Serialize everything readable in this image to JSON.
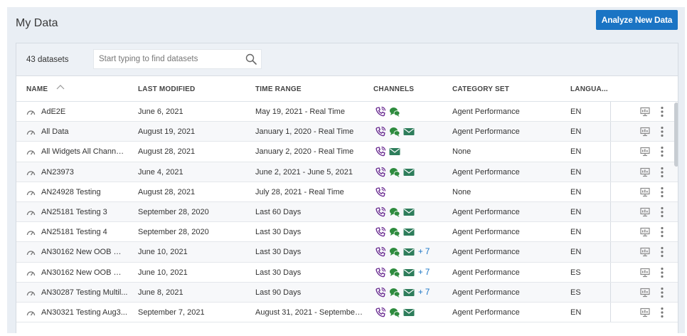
{
  "page": {
    "title": "My Data",
    "analyze_button": "Analyze New Data"
  },
  "toolbar": {
    "count": "43 datasets",
    "search_placeholder": "Start typing to find datasets"
  },
  "columns": {
    "name": "NAME",
    "last_modified": "LAST MODIFIED",
    "time_range": "TIME RANGE",
    "channels": "CHANNELS",
    "category_set": "CATEGORY SET",
    "language": "LANGUA..."
  },
  "colors": {
    "accent": "#1a74c4",
    "voice": "#6a2c91",
    "chat": "#2e8b3e",
    "email": "#2e7d5b"
  },
  "rows": [
    {
      "name": "AdE2E",
      "modified": "June 6, 2021",
      "time_range": "May 19, 2021 - Real Time",
      "channels": [
        "voice",
        "chat"
      ],
      "more": "",
      "category": "Agent Performance",
      "lang": "EN"
    },
    {
      "name": "All Data",
      "modified": "August 19, 2021",
      "time_range": "January 1, 2020 - Real Time",
      "channels": [
        "voice",
        "chat",
        "email"
      ],
      "more": "",
      "category": "Agent Performance",
      "lang": "EN"
    },
    {
      "name": "All Widgets All Channel...",
      "modified": "August 28, 2021",
      "time_range": "January 2, 2020 - Real Time",
      "channels": [
        "voice",
        "email"
      ],
      "more": "",
      "category": "None",
      "lang": "EN"
    },
    {
      "name": "AN23973",
      "modified": "June 4, 2021",
      "time_range": "June 2, 2021 - June 5, 2021",
      "channels": [
        "voice",
        "chat",
        "email"
      ],
      "more": "",
      "category": "Agent Performance",
      "lang": "EN"
    },
    {
      "name": "AN24928 Testing",
      "modified": "August 28, 2021",
      "time_range": "July 28, 2021 - Real Time",
      "channels": [
        "voice"
      ],
      "more": "",
      "category": "None",
      "lang": "EN"
    },
    {
      "name": "AN25181 Testing 3",
      "modified": "September 28, 2020",
      "time_range": "Last 60 Days",
      "channels": [
        "voice",
        "chat",
        "email"
      ],
      "more": "",
      "category": "Agent Performance",
      "lang": "EN"
    },
    {
      "name": "AN25181 Testing 4",
      "modified": "September 28, 2020",
      "time_range": "Last 30 Days",
      "channels": [
        "voice",
        "chat",
        "email"
      ],
      "more": "",
      "category": "Agent Performance",
      "lang": "EN"
    },
    {
      "name": "AN30162 New OOB Wo...",
      "modified": "June 10, 2021",
      "time_range": "Last 30 Days",
      "channels": [
        "voice",
        "chat",
        "email"
      ],
      "more": "+ 7",
      "category": "Agent Performance",
      "lang": "EN"
    },
    {
      "name": "AN30162 New OOB Wo...",
      "modified": "June 10, 2021",
      "time_range": "Last 30 Days",
      "channels": [
        "voice",
        "chat",
        "email"
      ],
      "more": "+ 7",
      "category": "Agent Performance",
      "lang": "ES"
    },
    {
      "name": "AN30287 Testing Multil...",
      "modified": "June 8, 2021",
      "time_range": "Last 90 Days",
      "channels": [
        "voice",
        "chat",
        "email"
      ],
      "more": "+ 7",
      "category": "Agent Performance",
      "lang": "ES"
    },
    {
      "name": "AN30321 Testing Aug3...",
      "modified": "September 7, 2021",
      "time_range": "August 31, 2021 - September ...",
      "channels": [
        "voice",
        "chat",
        "email"
      ],
      "more": "",
      "category": "Agent Performance",
      "lang": "EN"
    }
  ]
}
